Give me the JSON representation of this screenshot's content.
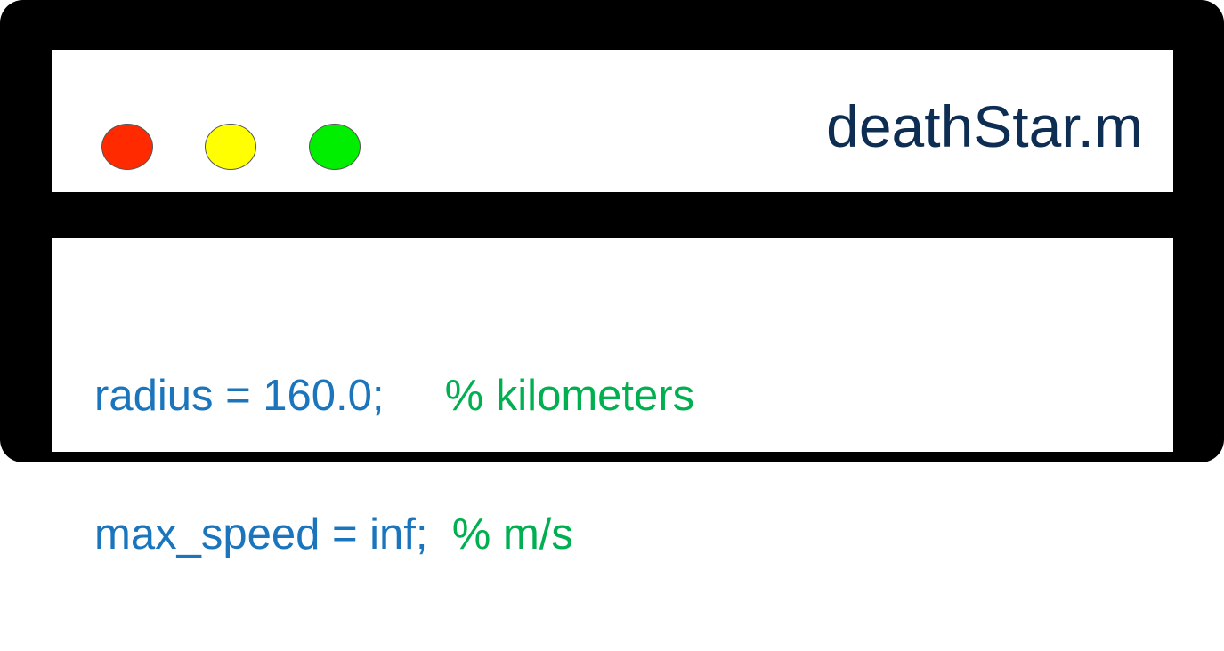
{
  "window": {
    "title": "deathStar.m",
    "traffic_lights": [
      {
        "name": "close",
        "color": "#ff2a00"
      },
      {
        "name": "minimize",
        "color": "#ffff00"
      },
      {
        "name": "zoom",
        "color": "#00ee00"
      }
    ]
  },
  "colors": {
    "frame": "#000000",
    "title_text": "#0d2d52",
    "code": "#1a75bd",
    "comment": "#00b050"
  },
  "editor": {
    "lines": [
      {
        "code": "radius = 160.0;     ",
        "comment": "% kilometers"
      },
      {
        "code": "max_speed = inf;  ",
        "comment": "% m/s"
      }
    ]
  }
}
